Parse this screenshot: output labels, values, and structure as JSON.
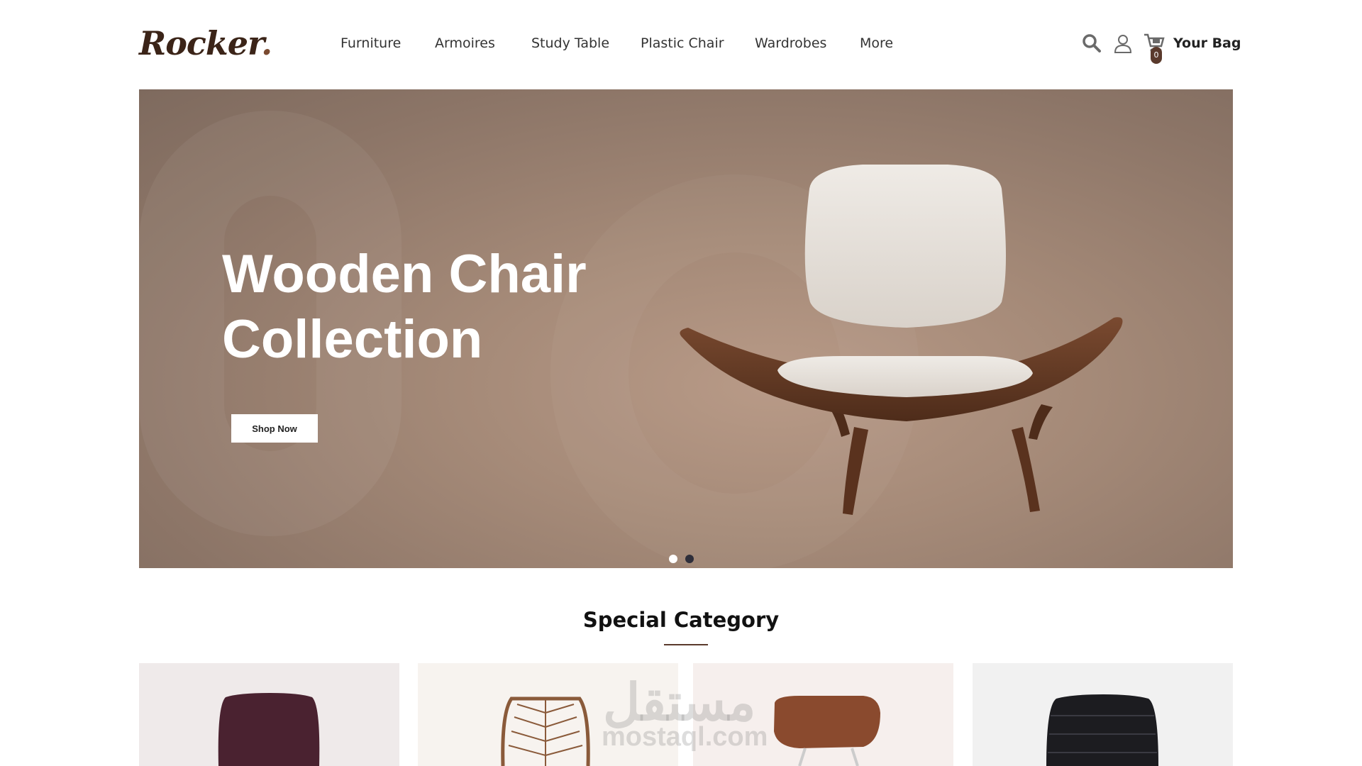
{
  "brand": {
    "logo": "Rocker",
    "logo_dot": "."
  },
  "nav": {
    "items": [
      "Furniture",
      "Armoires",
      "Study Table",
      "Plastic Chair",
      "Wardrobes",
      "More"
    ]
  },
  "header_actions": {
    "bag_count": "0",
    "bag_label": "Your Bag"
  },
  "hero": {
    "title_line1": "Wooden Chair",
    "title_line2": "Collection",
    "cta": "Shop Now",
    "slides_total": 2,
    "active_slide": 1
  },
  "section": {
    "title": "Special Category"
  },
  "categories": [
    {
      "name": "purple-chair",
      "bg": "#efeaea",
      "color": "#4a2230"
    },
    {
      "name": "rattan-chair",
      "bg": "#f7f3ef",
      "color": "#8a5a3a"
    },
    {
      "name": "leather-stool",
      "bg": "#f6efed",
      "color": "#8a4a2e"
    },
    {
      "name": "black-chair",
      "bg": "#f1f1f1",
      "color": "#1c1c20"
    }
  ],
  "watermark": {
    "arabic": "مستقل",
    "latin": "mostaql.com"
  },
  "colors": {
    "accent": "#5a3a2c",
    "hero_bg": "#a58a78",
    "dot_active": "#ffffff",
    "dot_inactive": "#2e2e3a"
  }
}
